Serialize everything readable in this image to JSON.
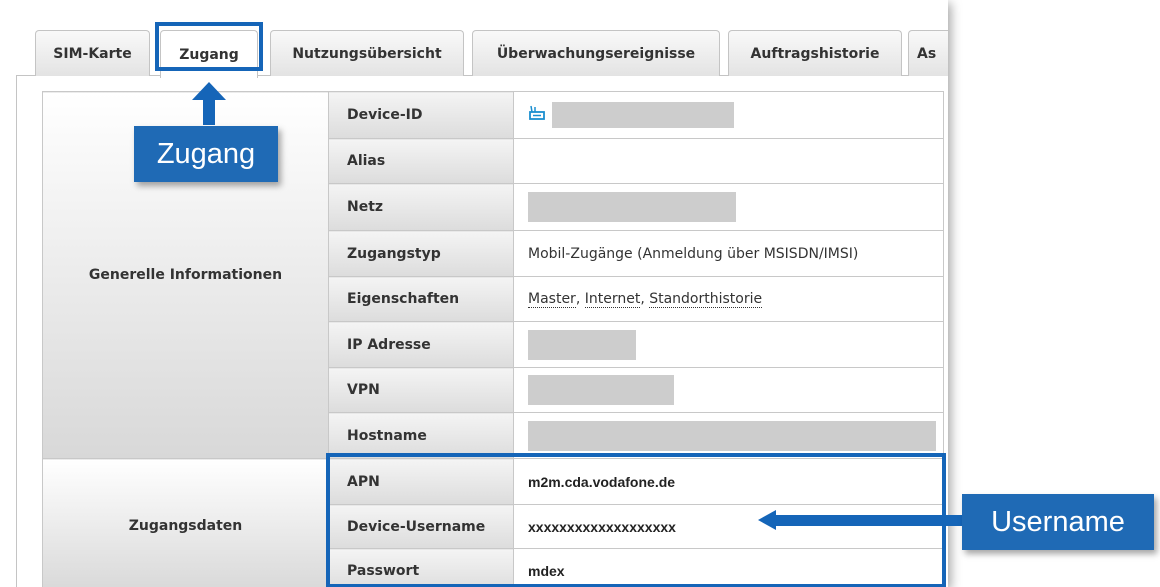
{
  "tabs": [
    {
      "label": "SIM-Karte",
      "active": false
    },
    {
      "label": "Zugang",
      "active": true
    },
    {
      "label": "Nutzungsübersicht",
      "active": false
    },
    {
      "label": "Überwachungsereignisse",
      "active": false
    },
    {
      "label": "Auftragshistorie",
      "active": false
    },
    {
      "label": "As",
      "active": false
    }
  ],
  "sections": {
    "general": "Generelle Informationen",
    "access": "Zugangsdaten"
  },
  "general_rows": {
    "device_id": {
      "label": "Device-ID",
      "icon": "router-icon"
    },
    "alias": {
      "label": "Alias",
      "value": ""
    },
    "netz": {
      "label": "Netz"
    },
    "zugangstyp": {
      "label": "Zugangstyp",
      "value": "Mobil-Zugänge (Anmeldung über MSISDN/IMSI)"
    },
    "eigenschaften": {
      "label": "Eigenschaften",
      "values": [
        "Master",
        "Internet",
        "Standorthistorie"
      ]
    },
    "ip": {
      "label": "IP Adresse"
    },
    "vpn": {
      "label": "VPN"
    },
    "hostname": {
      "label": "Hostname"
    }
  },
  "access_rows": {
    "apn": {
      "label": "APN",
      "value": "m2m.cda.vodafone.de"
    },
    "username": {
      "label": "Device-Username",
      "value": "xxxxxxxxxxxxxxxxxxx"
    },
    "password": {
      "label": "Passwort",
      "value": "mdex"
    }
  },
  "annotations": {
    "zugang_callout": "Zugang",
    "username_callout": "Username",
    "accent_color": "#1565b8"
  }
}
